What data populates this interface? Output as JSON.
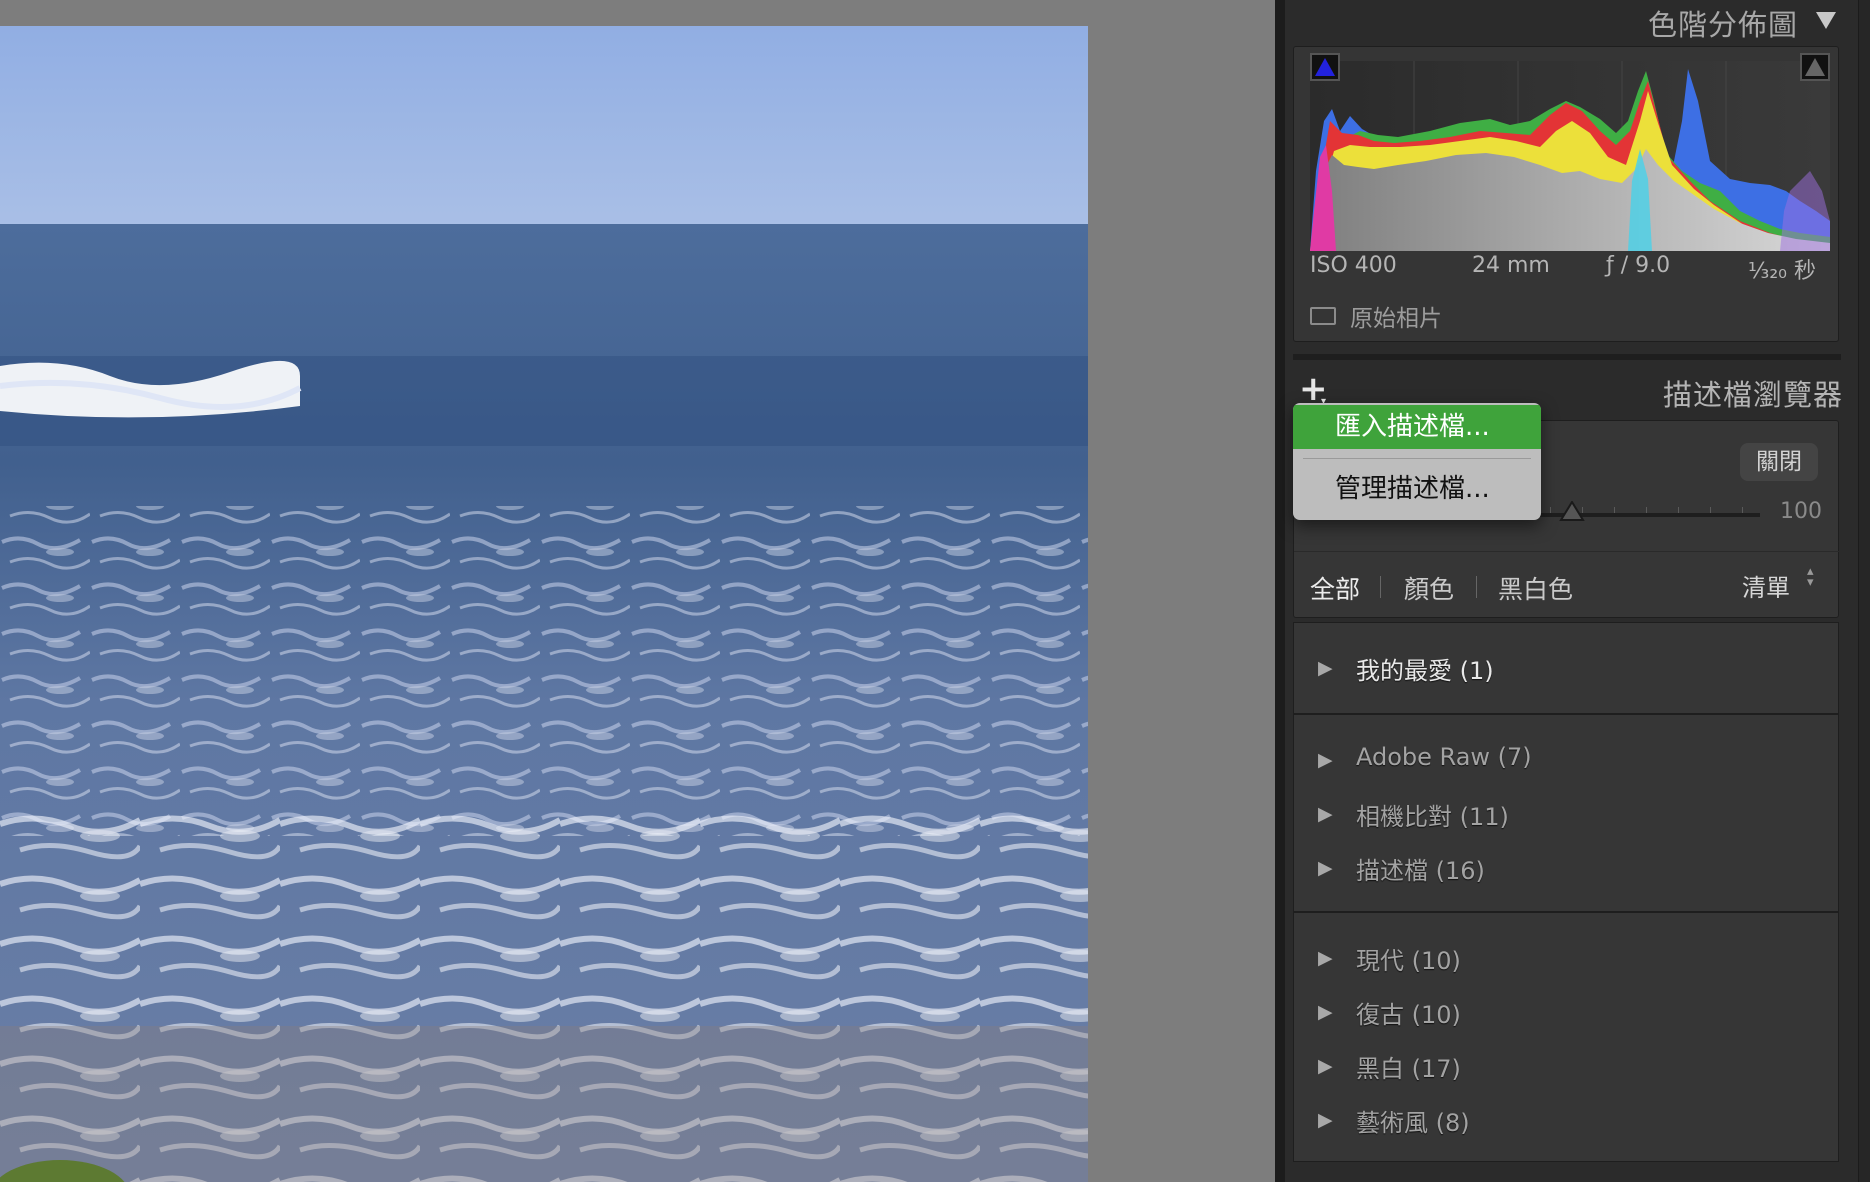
{
  "histogram_panel": {
    "title": "色階分佈圖",
    "collapse_icon": "triangle-down-icon",
    "exif": {
      "iso": "ISO 400",
      "focal_length": "24 mm",
      "aperture": "ƒ / 9.0",
      "shutter": "¹⁄₃₂₀ 秒"
    },
    "original_photo_label": "原始相片"
  },
  "profile_browser": {
    "title": "描述檔瀏覽器",
    "add_icon": "plus-icon",
    "close_button": "關閉",
    "amount_value": "100",
    "filters": [
      "全部",
      "顏色",
      "黑白色"
    ],
    "view_mode": "清單",
    "groups": [
      {
        "rows": [
          "我的最愛 (1)"
        ]
      },
      {
        "rows": [
          "Adobe Raw (7)",
          "相機比對 (11)",
          "描述檔 (16)"
        ]
      },
      {
        "rows": [
          "現代 (10)",
          "復古 (10)",
          "黑白 (17)",
          "藝術風 (8)"
        ]
      }
    ]
  },
  "dropdown_menu": {
    "items": [
      "匯入描述檔...",
      "管理描述檔..."
    ],
    "active_index": 0,
    "active_color": "#3fa33b"
  }
}
